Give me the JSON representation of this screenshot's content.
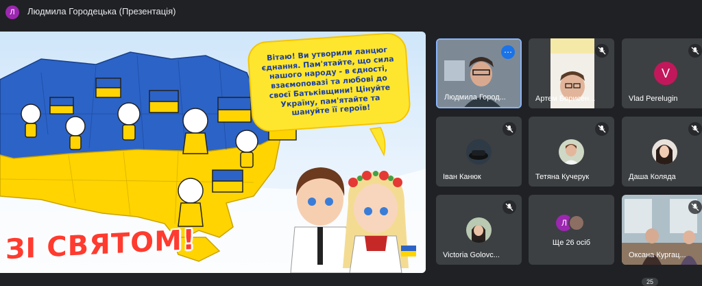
{
  "header": {
    "avatar_letter": "Л",
    "title": "Людмила Городецька (Презентація)",
    "avatar_color": "#9c27b0"
  },
  "slide": {
    "bubble_text": "Вітаю! Ви утворили ланцюг єднання. Пам'ятайте, що сила нашого народу - в єдності, взаємоповазі та любові до своєї Батьківщини! Цінуйте Україну, пам'ятайте та шануйте її героїв!",
    "greeting": "ЗІ СВЯТОМ!",
    "colors": {
      "blue": "#2c63c7",
      "yellow": "#ffd400",
      "red": "#ff3b2f"
    }
  },
  "participants": [
    {
      "name": "Людмила Город...",
      "type": "video",
      "active": true
    },
    {
      "name": "Артем Борисен...",
      "type": "video",
      "muted": true
    },
    {
      "name": "Vlad Perelugin",
      "type": "letter",
      "letter": "V",
      "muted": true
    },
    {
      "name": "Іван Канюк",
      "type": "photo",
      "muted": true
    },
    {
      "name": "Тетяна Кучерук",
      "type": "photo",
      "muted": true
    },
    {
      "name": "Даша Коляда",
      "type": "photo",
      "muted": true
    },
    {
      "name": "Victoria Golovc...",
      "type": "photo",
      "muted": true
    },
    {
      "name": "Ще 26 осіб",
      "type": "more",
      "letter": "Л"
    },
    {
      "name": "Оксана Кургац...",
      "type": "video",
      "muted": true
    }
  ],
  "footer": {
    "count": "25"
  },
  "icons": {
    "mute": "mic-off-icon",
    "more": "more-options-icon"
  }
}
